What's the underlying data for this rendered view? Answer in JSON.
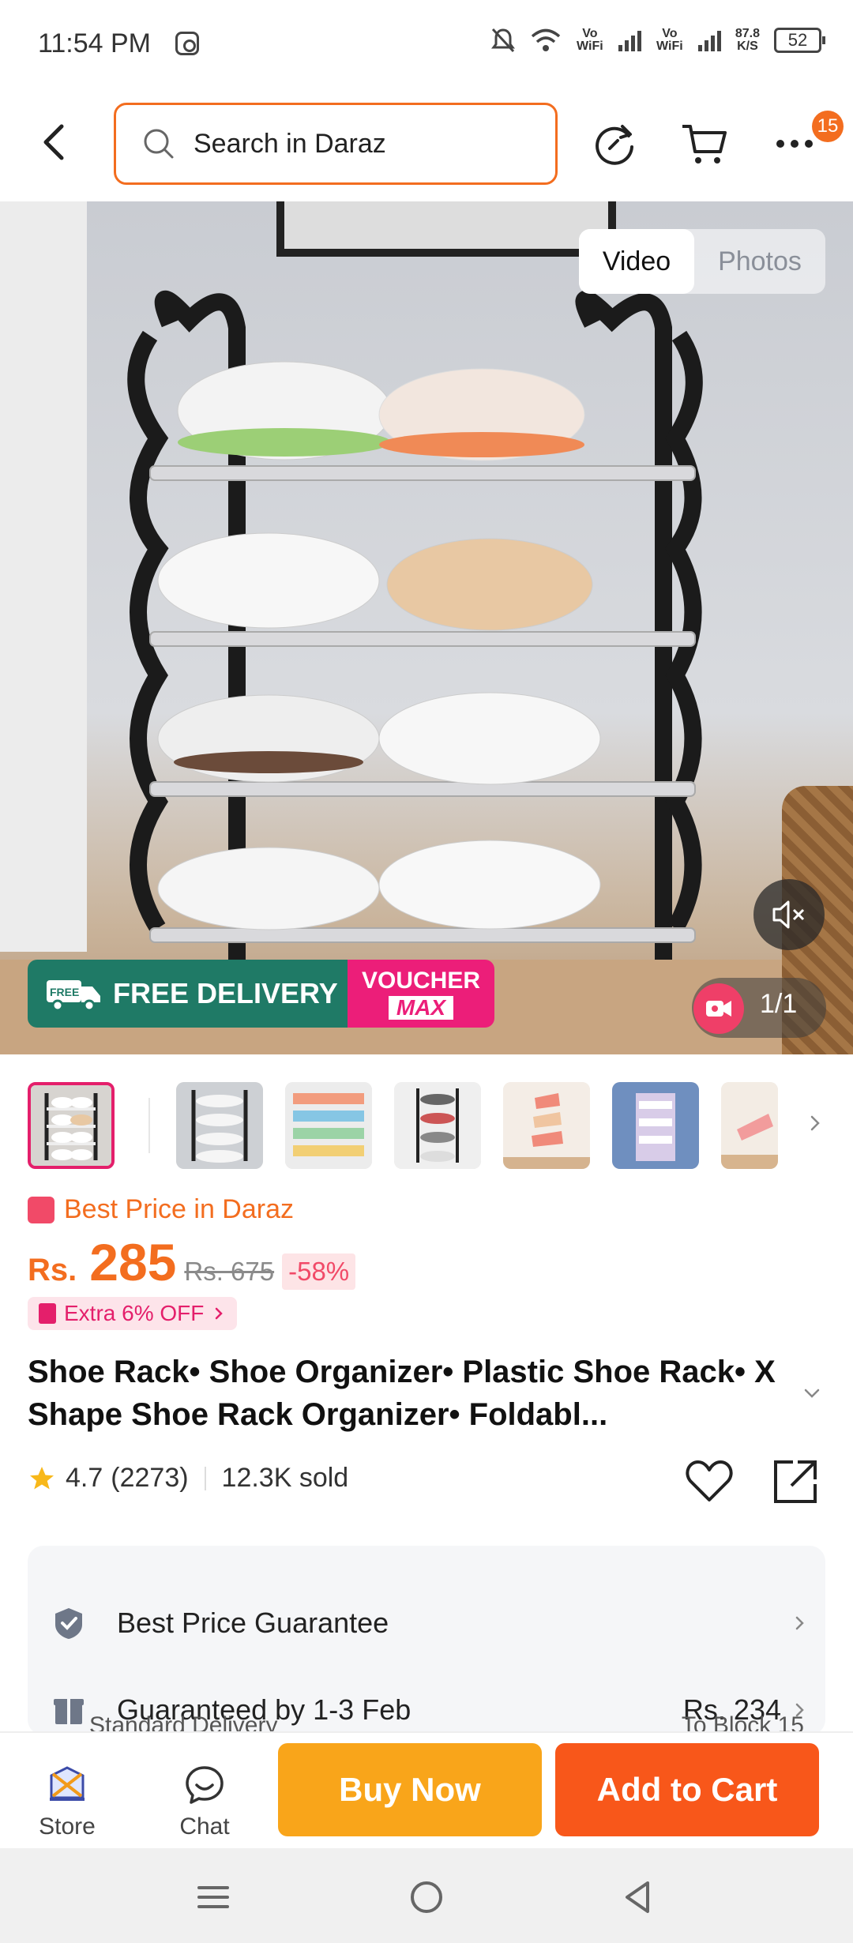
{
  "status_bar": {
    "time": "11:54 PM",
    "net_speed": "87.8",
    "net_unit": "K/S",
    "battery": "52",
    "sim1": "Vo WiFi",
    "sim2": "Vo WiFi"
  },
  "header": {
    "search_placeholder": "Search in Daraz",
    "cart_count": "15"
  },
  "media": {
    "tab_video": "Video",
    "tab_photos": "Photos",
    "counter": "1/1",
    "free_delivery": "FREE DELIVERY",
    "free_tag": "FREE",
    "voucher_line1": "VOUCHER",
    "voucher_line2": "MAX"
  },
  "pricing": {
    "best_price_label": "Best Price in Daraz",
    "currency": "Rs.",
    "price": "285",
    "old_price": "Rs. 675",
    "discount": "-58%",
    "extra_off": "Extra 6% OFF"
  },
  "product": {
    "title": "Shoe Rack• Shoe Organizer• Plastic Shoe Rack• X Shape Shoe Rack Organizer• Foldabl...",
    "rating": "4.7",
    "reviews": "(2273)",
    "sold": "12.3K sold"
  },
  "info": {
    "guarantee": "Best Price Guarantee",
    "delivery_label": "Guaranteed by 1-3 Feb",
    "delivery_price": "Rs. 234",
    "delivery_type": "Standard Delivery",
    "delivery_to": "To Block 15"
  },
  "bottom_bar": {
    "store": "Store",
    "chat": "Chat",
    "buy_now": "Buy Now",
    "add_to_cart": "Add to Cart"
  },
  "colors": {
    "brand_orange": "#f36d1f",
    "buy_now": "#f9a51a",
    "add_to_cart": "#f8571a",
    "pink": "#e41f6b",
    "free_delivery_green": "#1f7a66"
  }
}
